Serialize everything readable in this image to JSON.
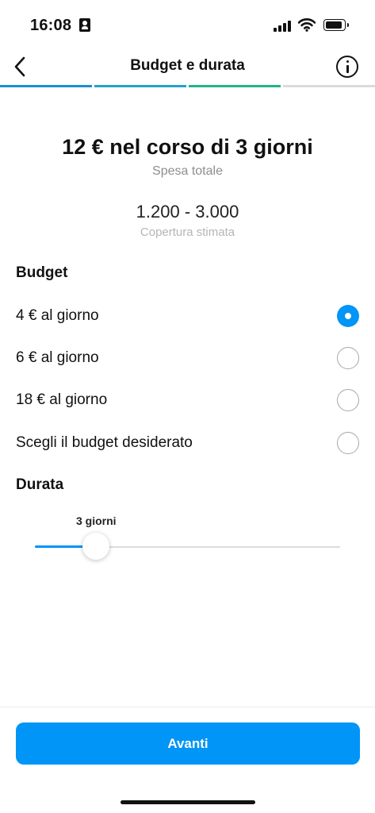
{
  "status_bar": {
    "time": "16:08",
    "icons": [
      "id-card-icon",
      "cellular-signal-icon",
      "wifi-icon",
      "battery-icon"
    ]
  },
  "header": {
    "title": "Budget e durata",
    "back_icon": "chevron-left-icon",
    "info_icon": "info-icon"
  },
  "progress": {
    "total_steps": 4,
    "completed_steps": 3,
    "colors": [
      "#1a8fd6",
      "#24a0c8",
      "#1fb58a",
      "#dbdbdb"
    ]
  },
  "summary": {
    "amount": "12 € nel corso di 3 giorni",
    "amount_caption": "Spesa totale",
    "reach": "1.200 - 3.000",
    "reach_caption": "Copertura stimata"
  },
  "budget": {
    "title": "Budget",
    "options": [
      {
        "label": "4 € al giorno",
        "selected": true
      },
      {
        "label": "6 € al giorno",
        "selected": false
      },
      {
        "label": "18 € al giorno",
        "selected": false
      },
      {
        "label": "Scegli il budget desiderato",
        "selected": false
      }
    ]
  },
  "duration": {
    "title": "Durata",
    "value_label": "3 giorni",
    "slider_fraction": 0.2
  },
  "footer": {
    "next_label": "Avanti"
  },
  "colors": {
    "accent": "#0095f6",
    "muted_text": "#8e8e8e"
  }
}
